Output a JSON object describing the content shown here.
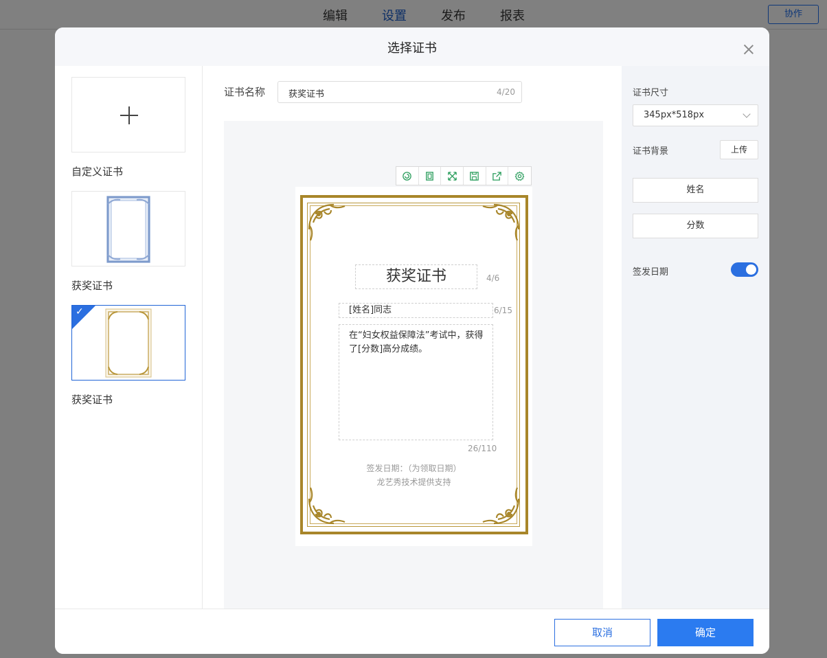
{
  "topnav": {
    "items": [
      "编辑",
      "设置",
      "发布",
      "报表"
    ],
    "active_index": 1,
    "collab_label": "协作"
  },
  "modal": {
    "title": "选择证书",
    "templates": [
      {
        "label": "自定义证书",
        "kind": "custom",
        "selected": false
      },
      {
        "label": "获奖证书",
        "kind": "blue-border",
        "selected": false
      },
      {
        "label": "获奖证书",
        "kind": "gold-border",
        "selected": true
      }
    ],
    "name_field": {
      "label": "证书名称",
      "value": "获奖证书",
      "counter": "4/20"
    },
    "toolbar_icons": [
      "refresh-icon",
      "copy-icon",
      "fullscreen-icon",
      "save-icon",
      "share-icon",
      "gear-icon"
    ],
    "certificate": {
      "title": "获奖证书",
      "title_counter": "4/6",
      "name_text": "[姓名]同志",
      "name_counter": "6/15",
      "body_text": "在“妇女权益保障法”考试中，获得了[分数]高分成绩。",
      "body_counter": "26/110",
      "date_text": "签发日期：（为领取日期）",
      "support_text": "龙艺秀技术提供支持"
    },
    "settings": {
      "size_label": "证书尺寸",
      "size_value": "345px*518px",
      "bg_label": "证书背景",
      "upload_label": "上传",
      "field_name_label": "姓名",
      "field_score_label": "分数",
      "date_label": "签发日期",
      "date_enabled": true
    },
    "footer": {
      "cancel_label": "取消",
      "ok_label": "确定"
    }
  },
  "colors": {
    "accent": "#2b7bf0",
    "gold": "#a8862a",
    "selected_border": "#1f64d6"
  }
}
